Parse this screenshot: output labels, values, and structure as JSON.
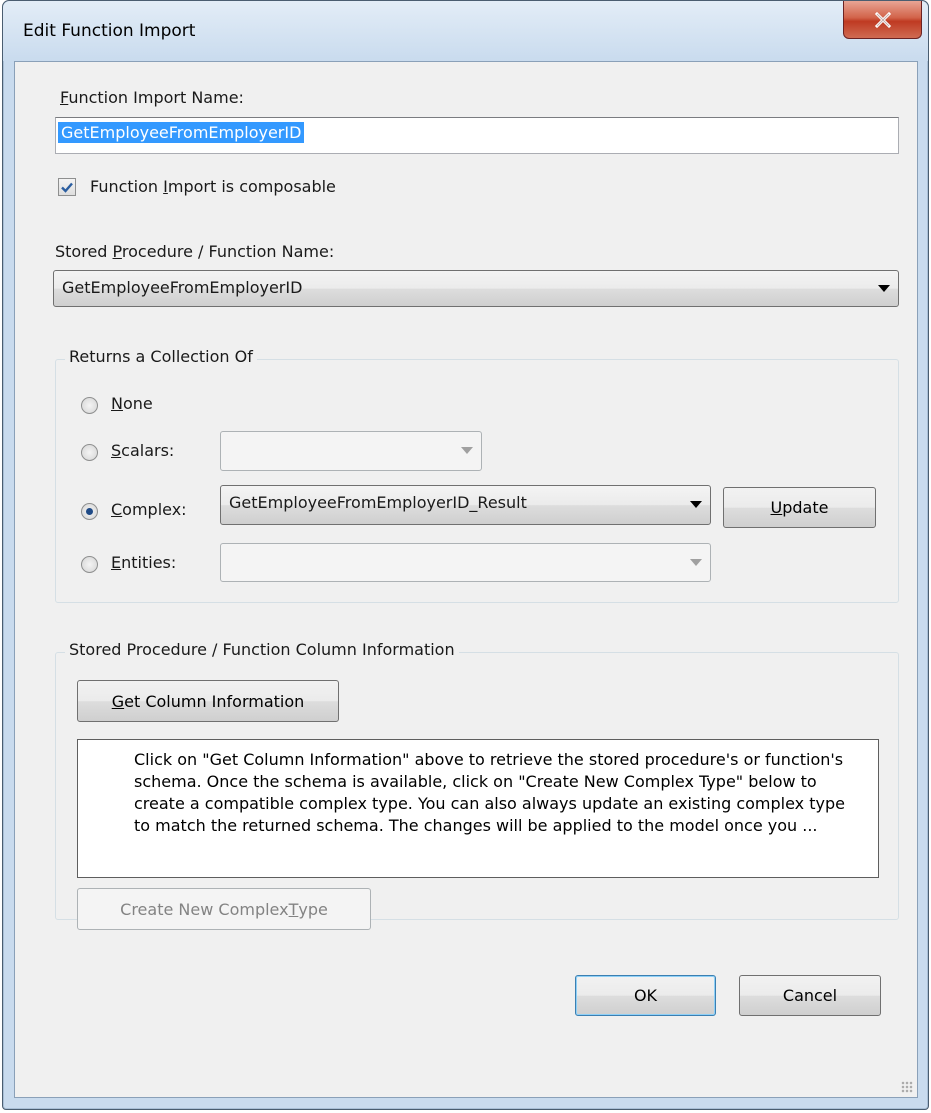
{
  "window": {
    "title": "Edit Function Import",
    "close_glyph": "X"
  },
  "function_import_name": {
    "label_prefix": "",
    "label_accel": "F",
    "label_rest": "unction Import Name:",
    "value": "GetEmployeeFromEmployerID"
  },
  "composable": {
    "checked": true,
    "label_prefix": "Function ",
    "label_accel": "I",
    "label_rest": "mport is composable"
  },
  "stored_procedure": {
    "label_prefix": "Stored ",
    "label_accel": "P",
    "label_rest": "rocedure / Function Name:",
    "selected": "GetEmployeeFromEmployerID"
  },
  "returns_group": {
    "title": "Returns a Collection Of",
    "options": {
      "none": {
        "accel": "N",
        "rest": "one",
        "selected": false
      },
      "scalars": {
        "accel": "S",
        "rest": "calars:",
        "selected": false,
        "combo_value": ""
      },
      "complex": {
        "accel": "C",
        "rest": "omplex:",
        "selected": true,
        "combo_value": "GetEmployeeFromEmployerID_Result"
      },
      "entities": {
        "accel": "E",
        "rest": "ntities:",
        "selected": false,
        "combo_value": ""
      }
    },
    "update_button": {
      "accel": "U",
      "rest": "pdate"
    }
  },
  "column_info_group": {
    "title": "Stored Procedure / Function Column Information",
    "get_column_button": {
      "accel": "G",
      "rest": "et Column Information"
    },
    "info_text": "Click on \"Get Column Information\" above to retrieve the stored procedure's or function's schema. Once the schema is available, click on \"Create New Complex Type\" below to create a compatible complex type. You can also always update an existing complex type to match the returned schema. The changes will be applied to the model once you ...",
    "create_button": {
      "prefix": "Create New Complex ",
      "accel": "T",
      "rest": "ype",
      "enabled": false
    }
  },
  "footer": {
    "ok_label": "OK",
    "cancel_label": "Cancel"
  }
}
